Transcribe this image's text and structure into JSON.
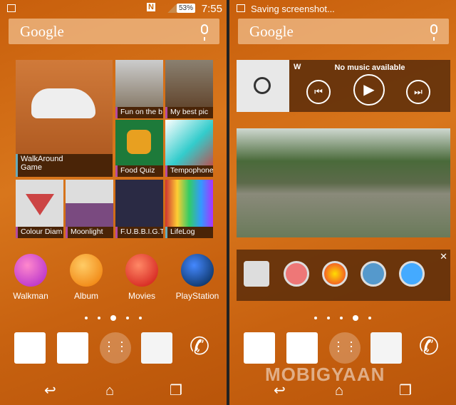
{
  "left": {
    "status": {
      "battery": "53%",
      "time": "7:55",
      "icons": [
        "screenshot-icon",
        "nfc-icon",
        "sim-icon",
        "signal-icon",
        "battery-icon"
      ]
    },
    "search": {
      "logo": "Google",
      "icon": "mic-icon"
    },
    "tiles": [
      {
        "title": "WalkAround",
        "subtitle": "Game"
      },
      {
        "title": "Fun on the b"
      },
      {
        "title": "My best pic"
      },
      {
        "title": "Food Quiz"
      },
      {
        "title": "Tempophone"
      },
      {
        "title": "Colour Diam"
      },
      {
        "title": "Moonlight"
      },
      {
        "title": "F.U.B.B.I.G.T"
      },
      {
        "title": "LifeLog"
      }
    ],
    "apps": [
      {
        "label": "Walkman"
      },
      {
        "label": "Album"
      },
      {
        "label": "Movies"
      },
      {
        "label": "PlayStation"
      }
    ],
    "page_dots": 5,
    "active_page": 3
  },
  "right": {
    "status": {
      "title": "Saving screenshot..."
    },
    "search": {
      "logo": "Google",
      "icon": "mic-icon"
    },
    "music": {
      "title": "No music available"
    },
    "page_dots": 5,
    "active_page": 4
  },
  "nav": {
    "icons": [
      "back-icon",
      "home-icon",
      "recents-icon"
    ]
  },
  "watermark": "MOBIGYAAN"
}
